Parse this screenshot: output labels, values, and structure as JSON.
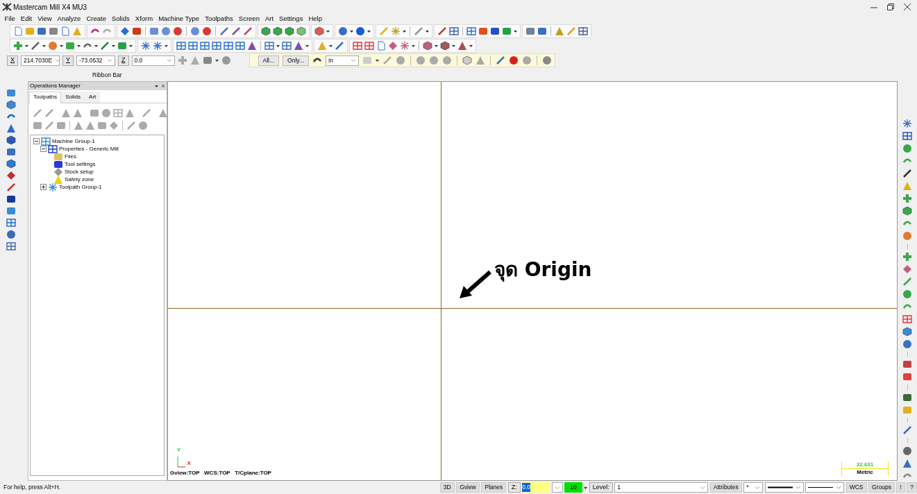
{
  "window": {
    "title": "Mastercam Mill X4 MU3"
  },
  "menu": [
    "File",
    "Edit",
    "View",
    "Analyze",
    "Create",
    "Solids",
    "Xform",
    "Machine Type",
    "Toolpaths",
    "Screen",
    "Art",
    "Settings",
    "Help"
  ],
  "coords": [
    {
      "label": "X",
      "value": "214.7030E"
    },
    {
      "label": "Y",
      "value": "-73.0532"
    },
    {
      "label": "Z",
      "value": "0.0"
    }
  ],
  "selection_bar": {
    "buttons": [
      "All...",
      "Only..."
    ],
    "mode": "In"
  },
  "ribbon_label": "Ribbon Bar",
  "operations_manager": {
    "title": "Operations Manager",
    "close": "x",
    "tabs": [
      {
        "label": "Toolpaths",
        "selected": true
      },
      {
        "label": "Solids",
        "selected": false
      },
      {
        "label": "Art",
        "selected": false
      }
    ],
    "tree": [
      {
        "label": "Machine Group-1",
        "kind": "group",
        "expanded": true,
        "children": [
          {
            "label": "Properties - Generic Mill",
            "kind": "properties",
            "expanded": true,
            "children": [
              {
                "label": "Files",
                "kind": "folder"
              },
              {
                "label": "Tool settings",
                "kind": "tool"
              },
              {
                "label": "Stock setup",
                "kind": "stock"
              },
              {
                "label": "Safety zone",
                "kind": "warning"
              }
            ]
          },
          {
            "label": "Toolpath Group-1",
            "kind": "toolpaths",
            "expanded": false
          }
        ]
      }
    ]
  },
  "viewport": {
    "annotation": "จุด Origin",
    "axis_x": "X",
    "axis_y": "Y",
    "view_info": "Gview:TOP   WCS:TOP   T/Cplane:TOP",
    "scale_value": "32.631",
    "scale_unit": "Metric"
  },
  "status_bar": {
    "help": "For help, press Alt+H.",
    "buttons": [
      "3D",
      "Gview",
      "Planes"
    ],
    "z_label": "Z:",
    "z_value": "0.0",
    "color_number": "10",
    "level_label": "Level:",
    "level_value": "1",
    "attributes": "Attributes",
    "point_style": "*",
    "right_buttons": [
      "WCS",
      "Groups",
      "!",
      "?"
    ]
  }
}
